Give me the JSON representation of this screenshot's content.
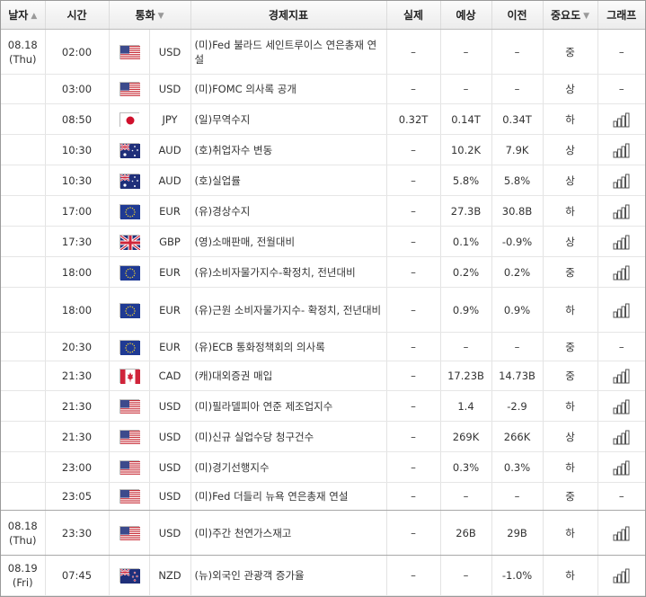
{
  "headers": {
    "date": "날자",
    "time": "시간",
    "currency": "통화",
    "indicator": "경제지표",
    "actual": "실제",
    "forecast": "예상",
    "previous": "이전",
    "importance": "중요도",
    "graph": "그래프"
  },
  "sort_arrows": {
    "down": "▼",
    "up": "▲"
  },
  "rows": [
    {
      "date": "08.18",
      "day": "(Thu)",
      "time": "02:00",
      "flag": "us",
      "currency": "USD",
      "indicator": "(미)Fed 불라드 세인트루이스 연은총재 연설",
      "actual": "–",
      "forecast": "–",
      "previous": "–",
      "importance": "중",
      "graph": "–"
    },
    {
      "date": "",
      "day": "",
      "time": "03:00",
      "flag": "us",
      "currency": "USD",
      "indicator": "(미)FOMC 의사록 공개",
      "actual": "–",
      "forecast": "–",
      "previous": "–",
      "importance": "상",
      "graph": "–"
    },
    {
      "date": "",
      "day": "",
      "time": "08:50",
      "flag": "jp",
      "currency": "JPY",
      "indicator": "(일)무역수지",
      "actual": "0.32T",
      "forecast": "0.14T",
      "previous": "0.34T",
      "importance": "하",
      "graph": "bars"
    },
    {
      "date": "",
      "day": "",
      "time": "10:30",
      "flag": "au",
      "currency": "AUD",
      "indicator": "(호)취업자수 변동",
      "actual": "–",
      "forecast": "10.2K",
      "previous": "7.9K",
      "importance": "상",
      "graph": "bars"
    },
    {
      "date": "",
      "day": "",
      "time": "10:30",
      "flag": "au",
      "currency": "AUD",
      "indicator": "(호)실업률",
      "actual": "–",
      "forecast": "5.8%",
      "previous": "5.8%",
      "importance": "상",
      "graph": "bars"
    },
    {
      "date": "",
      "day": "",
      "time": "17:00",
      "flag": "eu",
      "currency": "EUR",
      "indicator": "(유)경상수지",
      "actual": "–",
      "forecast": "27.3B",
      "previous": "30.8B",
      "importance": "하",
      "graph": "bars"
    },
    {
      "date": "",
      "day": "",
      "time": "17:30",
      "flag": "gb",
      "currency": "GBP",
      "indicator": "(영)소매판매, 전월대비",
      "actual": "–",
      "forecast": "0.1%",
      "previous": "-0.9%",
      "importance": "상",
      "graph": "bars"
    },
    {
      "date": "",
      "day": "",
      "time": "18:00",
      "flag": "eu",
      "currency": "EUR",
      "indicator": "(유)소비자물가지수-확정치, 전년대비",
      "actual": "–",
      "forecast": "0.2%",
      "previous": "0.2%",
      "importance": "중",
      "graph": "bars"
    },
    {
      "date": "",
      "day": "",
      "time": "18:00",
      "flag": "eu",
      "currency": "EUR",
      "indicator": "(유)근원 소비자물가지수- 확정치, 전년대비",
      "actual": "–",
      "forecast": "0.9%",
      "previous": "0.9%",
      "importance": "하",
      "graph": "bars"
    },
    {
      "date": "",
      "day": "",
      "time": "20:30",
      "flag": "eu",
      "currency": "EUR",
      "indicator": "(유)ECB 통화정책회의 의사록",
      "actual": "–",
      "forecast": "–",
      "previous": "–",
      "importance": "중",
      "graph": "–"
    },
    {
      "date": "",
      "day": "",
      "time": "21:30",
      "flag": "ca",
      "currency": "CAD",
      "indicator": "(캐)대외증권 매입",
      "actual": "–",
      "forecast": "17.23B",
      "previous": "14.73B",
      "importance": "중",
      "graph": "bars"
    },
    {
      "date": "",
      "day": "",
      "time": "21:30",
      "flag": "us",
      "currency": "USD",
      "indicator": "(미)필라델피아 연준 제조업지수",
      "actual": "–",
      "forecast": "1.4",
      "previous": "-2.9",
      "importance": "하",
      "graph": "bars"
    },
    {
      "date": "",
      "day": "",
      "time": "21:30",
      "flag": "us",
      "currency": "USD",
      "indicator": "(미)신규 실업수당 청구건수",
      "actual": "–",
      "forecast": "269K",
      "previous": "266K",
      "importance": "상",
      "graph": "bars"
    },
    {
      "date": "",
      "day": "",
      "time": "23:00",
      "flag": "us",
      "currency": "USD",
      "indicator": "(미)경기선행지수",
      "actual": "–",
      "forecast": "0.3%",
      "previous": "0.3%",
      "importance": "하",
      "graph": "bars"
    },
    {
      "date": "",
      "day": "",
      "time": "23:05",
      "flag": "us",
      "currency": "USD",
      "indicator": "(미)Fed 더들리 뉴욕 연은총재 연설",
      "actual": "–",
      "forecast": "–",
      "previous": "–",
      "importance": "중",
      "graph": "–"
    },
    {
      "date": "08.18",
      "day": "(Thu)",
      "time": "23:30",
      "flag": "us",
      "currency": "USD",
      "indicator": "(미)주간 천연가스재고",
      "actual": "–",
      "forecast": "26B",
      "previous": "29B",
      "importance": "하",
      "graph": "bars"
    },
    {
      "date": "08.19",
      "day": "(Fri)",
      "time": "07:45",
      "flag": "nz",
      "currency": "NZD",
      "indicator": "(뉴)외국인 관광객 증가율",
      "actual": "–",
      "forecast": "–",
      "previous": "-1.0%",
      "importance": "하",
      "graph": "bars"
    }
  ]
}
